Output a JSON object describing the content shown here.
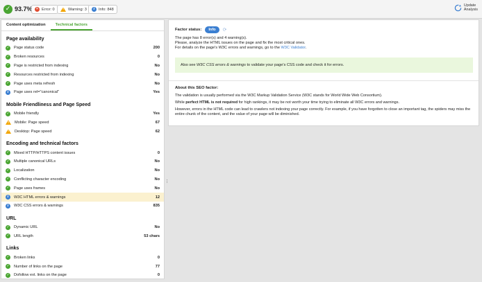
{
  "topbar": {
    "score": "93.7%",
    "error_label": "Error: 0",
    "warning_label": "Warning: 3",
    "info_label": "Info: 848",
    "update_line1": "Update",
    "update_line2": "Analysis"
  },
  "tabs": [
    {
      "label": "Content optimization",
      "active": false
    },
    {
      "label": "Technical factors",
      "active": true
    }
  ],
  "groups": [
    {
      "title": "Page availability",
      "items": [
        {
          "icon": "ok",
          "label": "Page status code",
          "value": "200"
        },
        {
          "icon": "ok",
          "label": "Broken resources",
          "value": "0"
        },
        {
          "icon": "ok",
          "label": "Page is restricted from indexing",
          "value": "No"
        },
        {
          "icon": "ok",
          "label": "Resources restricted from indexing",
          "value": "No"
        },
        {
          "icon": "ok",
          "label": "Page uses meta refresh",
          "value": "No"
        },
        {
          "icon": "info",
          "label": "Page uses rel=\"canonical\"",
          "value": "Yes"
        }
      ]
    },
    {
      "title": "Mobile Friendliness and Page Speed",
      "items": [
        {
          "icon": "ok",
          "label": "Mobile friendly",
          "value": "Yes"
        },
        {
          "icon": "warn",
          "label": "Mobile: Page speed",
          "value": "67"
        },
        {
          "icon": "warn",
          "label": "Desktop: Page speed",
          "value": "62"
        }
      ]
    },
    {
      "title": "Encoding and technical factors",
      "items": [
        {
          "icon": "ok",
          "label": "Mixed HTTP/HTTPS content issues",
          "value": "0"
        },
        {
          "icon": "ok",
          "label": "Multiple canonical URLs",
          "value": "No"
        },
        {
          "icon": "ok",
          "label": "Localization",
          "value": "No"
        },
        {
          "icon": "ok",
          "label": "Conflicting character encoding",
          "value": "No"
        },
        {
          "icon": "ok",
          "label": "Page uses frames",
          "value": "No"
        },
        {
          "icon": "info",
          "label": "W3C HTML errors & warnings",
          "value": "12",
          "selected": true
        },
        {
          "icon": "info",
          "label": "W3C CSS errors & warnings",
          "value": "835"
        }
      ]
    },
    {
      "title": "URL",
      "items": [
        {
          "icon": "ok",
          "label": "Dynamic URL",
          "value": "No"
        },
        {
          "icon": "ok",
          "label": "URL length",
          "value": "53 chars"
        }
      ]
    },
    {
      "title": "Links",
      "items": [
        {
          "icon": "ok",
          "label": "Broken links",
          "value": "0"
        },
        {
          "icon": "ok",
          "label": "Number of links on the page",
          "value": "77"
        },
        {
          "icon": "ok",
          "label": "Dofollow ext. links on the page",
          "value": "0"
        }
      ]
    }
  ],
  "detail": {
    "status_label": "Factor status:",
    "status_badge": "Info",
    "msg_line1": "The page has 8 error(s) and 4 warning(s).",
    "msg_line2": "Please, analyze the HTML issues on the page and fix the most critical ones.",
    "msg_line3_prefix": "For details on the page's W3C errors and warnings, go to the ",
    "msg_link": "W3C Validator",
    "msg_line3_suffix": ".",
    "hint_prefix": "Also see ",
    "hint_em": "W3C CSS errors & warnings",
    "hint_suffix": " to validate your page's CSS code and check it for errors.",
    "about_title": "About this SEO factor:",
    "about_p1": "The validation is usually performed via the W3C Markup Validation Service (W3C stands for World Wide Web Consortium).",
    "about_p2_prefix": "While ",
    "about_p2_bold": "perfect HTML is not required",
    "about_p2_suffix": " for high rankings, it may be not worth your time trying to eliminate all W3C errors and warnings.",
    "about_p3": "However, errors in the HTML code can lead to crawlers not indexing your page correctly. For example, if you have forgotten to close an important tag, the spiders may miss the entire chunk of the content, and the value of your page will be diminished."
  },
  "colors": {
    "ok": "#4aa532",
    "error": "#e04b30",
    "warning": "#f2a500",
    "info": "#3b7fd1",
    "selected_row": "#fbf1cf",
    "hint_bg": "#eaf7dd"
  }
}
